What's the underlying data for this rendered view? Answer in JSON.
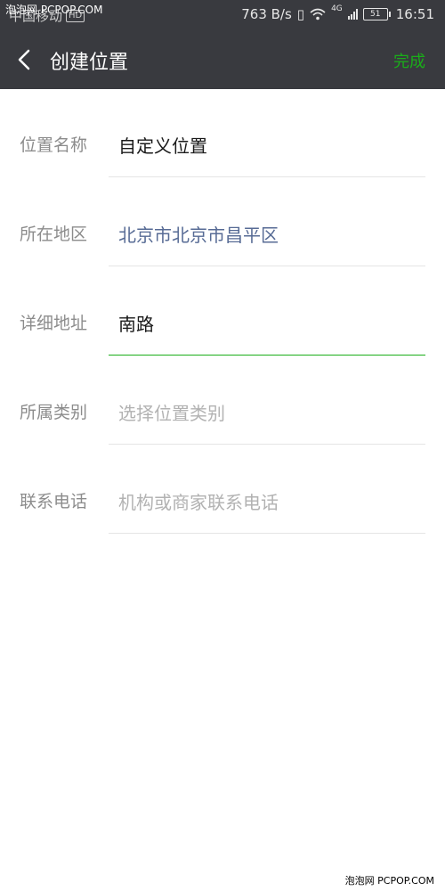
{
  "status_bar": {
    "carrier": "中国移动",
    "hd_badge": "HD",
    "network_speed": "763 B/s",
    "network_type": "4G",
    "battery": "51",
    "time": "16:51"
  },
  "watermark": {
    "top": "泡泡网 PCPOP.COM",
    "bottom": "泡泡网 PCPOP.COM"
  },
  "header": {
    "title": "创建位置",
    "done_label": "完成"
  },
  "form": {
    "fields": [
      {
        "label": "位置名称",
        "value": "自定义位置"
      },
      {
        "label": "所在地区",
        "value": "北京市北京市昌平区"
      },
      {
        "label": "详细地址",
        "value": "南路"
      },
      {
        "label": "所属类别",
        "placeholder": "选择位置类别"
      },
      {
        "label": "联系电话",
        "placeholder": "机构或商家联系电话"
      }
    ]
  },
  "colors": {
    "header_bg": "#393a3f",
    "accent_green": "#1aad19",
    "region_blue": "#576b95"
  }
}
